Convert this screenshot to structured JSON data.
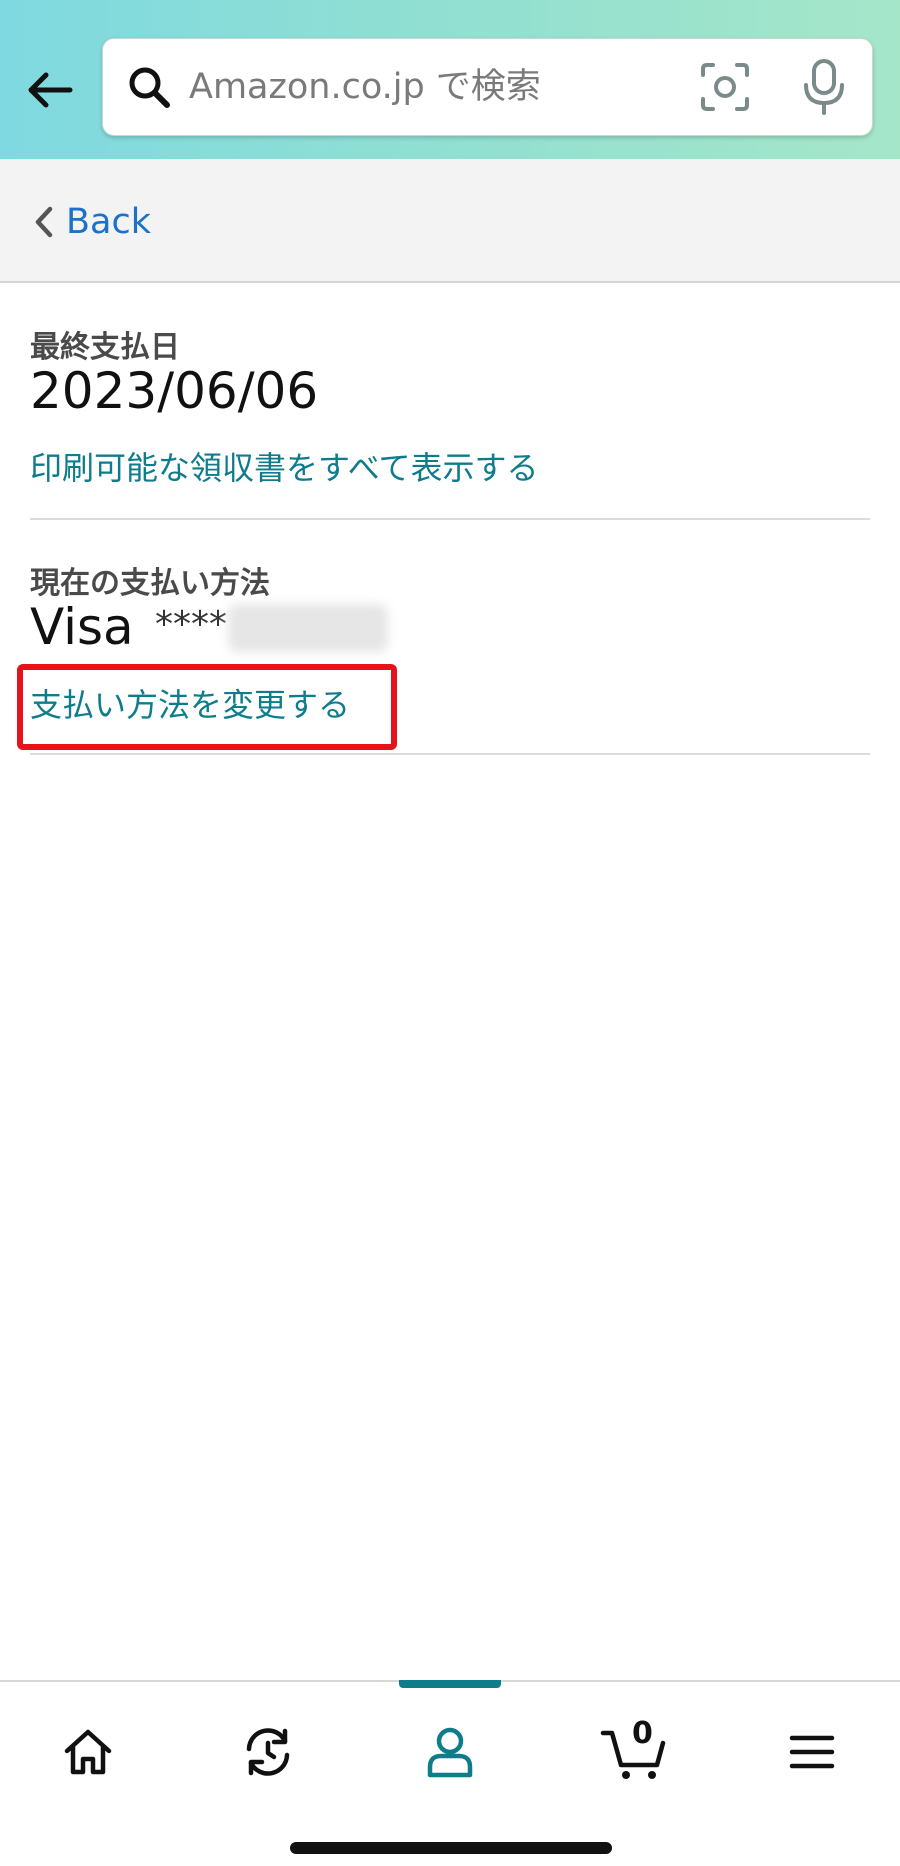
{
  "header": {
    "search_placeholder": "Amazon.co.jp で検索"
  },
  "nav": {
    "back_label": "Back"
  },
  "last_payment": {
    "label": "最終支払日",
    "date": "2023/06/06",
    "receipts_link": "印刷可能な領収書をすべて表示する"
  },
  "payment_method": {
    "label": "現在の支払い方法",
    "card_brand": "Visa",
    "card_mask": "****",
    "change_link": "支払い方法を変更する"
  },
  "bottom_nav": {
    "items": [
      "home-icon",
      "refresh-icon",
      "account-icon",
      "cart-icon",
      "menu-icon"
    ],
    "cart_count": "0",
    "active_color": "#0f7c8c"
  },
  "colors": {
    "link": "#0f7c8c",
    "back_link": "#1a73c9",
    "highlight": "#e8121c"
  }
}
